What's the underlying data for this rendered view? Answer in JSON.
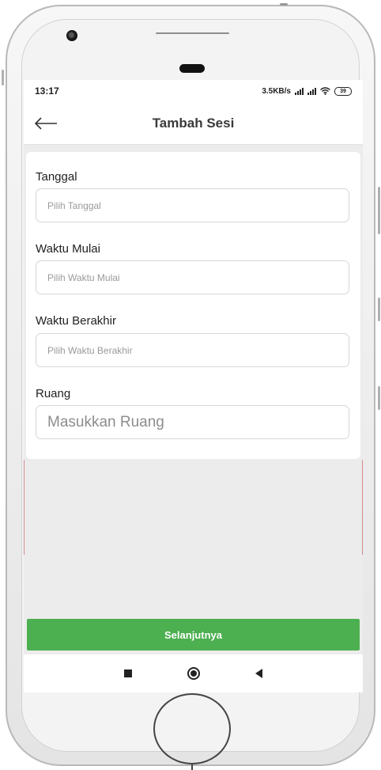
{
  "status_bar": {
    "time": "13:17",
    "network_speed": "3.5KB/s",
    "battery": "39",
    "icons": [
      "signal-icon",
      "signal-icon",
      "wifi-icon",
      "battery-icon"
    ]
  },
  "app_bar": {
    "title": "Tambah Sesi",
    "back_icon": "arrow-left-icon"
  },
  "form": {
    "tanggal": {
      "label": "Tanggal",
      "placeholder": "Pilih Tanggal",
      "value": ""
    },
    "waktu_mulai": {
      "label": "Waktu Mulai",
      "placeholder": "Pilih Waktu Mulai",
      "value": ""
    },
    "waktu_berakhir": {
      "label": "Waktu Berakhir",
      "placeholder": "Pilih Waktu Berakhir",
      "value": ""
    },
    "ruang": {
      "label": "Ruang",
      "placeholder": "Masukkan Ruang",
      "value": ""
    }
  },
  "actions": {
    "next_label": "Selanjutnya"
  },
  "nav_bar": {
    "icons": [
      "recents-icon",
      "home-icon",
      "back-icon"
    ]
  },
  "colors": {
    "primary_button": "#4caf50",
    "screen_background": "#ececec",
    "card_background": "#ffffff"
  }
}
